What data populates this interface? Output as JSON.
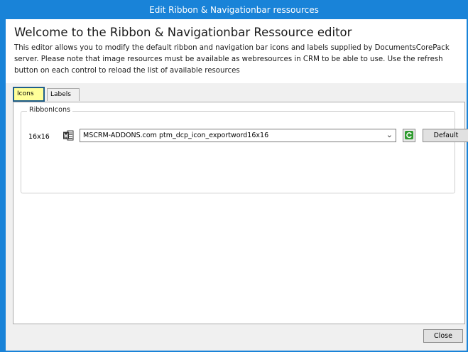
{
  "window": {
    "title": "Edit Ribbon & Navigationbar ressources",
    "accent_color": "#1983d8"
  },
  "header": {
    "welcome": "Welcome to the Ribbon & Navigationbar Ressource editor",
    "description": "This editor allows you to modify the default ribbon and navigation bar icons and labels supplied by DocumentsCorePack server. Please note that image resources must be available as webresources in CRM to be able to use. Use the refresh button on each control to reload the list of available resources"
  },
  "tabs": [
    {
      "label": "Icons",
      "selected": true
    },
    {
      "label": "Labels",
      "selected": false
    }
  ],
  "ribbon_icons": {
    "group_label": "RibbonIcons",
    "row": {
      "size_label": "16x16",
      "icon": "word-document-icon",
      "selected_value": "MSCRM-ADDONS.com ptm_dcp_icon_exportword16x16",
      "refresh_icon": "refresh-icon",
      "default_label": "Default"
    }
  },
  "footer": {
    "close_label": "Close"
  }
}
